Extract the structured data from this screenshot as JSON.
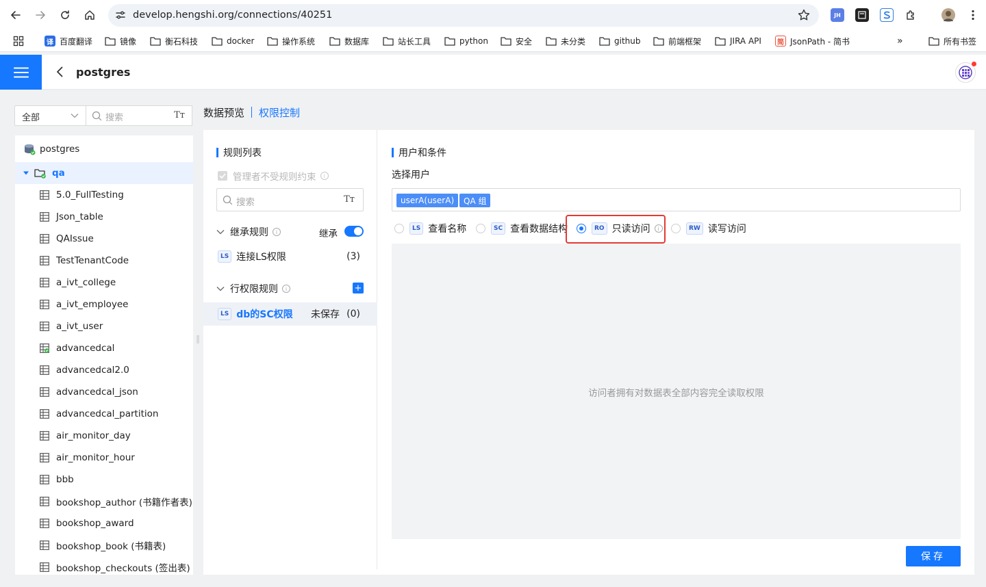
{
  "browser": {
    "url": "develop.hengshi.org/connections/40251",
    "extensions": [
      "JH"
    ]
  },
  "bookmarks": {
    "items": [
      {
        "label": "百度翻译",
        "icon": "baidu-translate-icon"
      },
      {
        "label": "镜像",
        "icon": "folder-icon"
      },
      {
        "label": "衡石科技",
        "icon": "folder-icon"
      },
      {
        "label": "docker",
        "icon": "folder-icon"
      },
      {
        "label": "操作系统",
        "icon": "folder-icon"
      },
      {
        "label": "数据库",
        "icon": "folder-icon"
      },
      {
        "label": "站长工具",
        "icon": "folder-icon"
      },
      {
        "label": "python",
        "icon": "folder-icon"
      },
      {
        "label": "安全",
        "icon": "folder-icon"
      },
      {
        "label": "未分类",
        "icon": "folder-icon"
      },
      {
        "label": "github",
        "icon": "folder-icon"
      },
      {
        "label": "前端框架",
        "icon": "folder-icon"
      },
      {
        "label": "JIRA API",
        "icon": "folder-icon"
      },
      {
        "label": "JsonPath - 简书",
        "icon": "jianshu-icon"
      }
    ],
    "more": "»",
    "all": "所有书签",
    "translate_logo": "译",
    "jianshu_logo": "简"
  },
  "app": {
    "title": "postgres",
    "accent": "#1677ff"
  },
  "filter": {
    "scope": "全部",
    "search_placeholder": "搜索",
    "font_toggle": "Tт"
  },
  "tree": {
    "root": "postgres",
    "schema": "qa",
    "tables": [
      "5.0_FullTesting",
      "Json_table",
      "QAIssue",
      "TestTenantCode",
      "a_ivt_college",
      "a_ivt_employee",
      "a_ivt_user",
      "advancedcal",
      "advancedcal2.0",
      "advancedcal_json",
      "advancedcal_partition",
      "air_monitor_day",
      "air_monitor_hour",
      "bbb",
      "bookshop_author (书籍作者表)",
      "bookshop_award",
      "bookshop_book (书籍表)",
      "bookshop_checkouts (签出表)"
    ]
  },
  "tabs": {
    "preview": "数据预览",
    "permission": "权限控制"
  },
  "rules": {
    "title": "规则列表",
    "admin_exempt": "管理者不受规则约束",
    "search_placeholder": "搜索",
    "font_toggle": "Tт",
    "inherit_group": "继承规则",
    "inherit_label": "继承",
    "inherit_on": true,
    "inherited": [
      {
        "tag": "LS",
        "name": "连接LS权限",
        "count": "(3)"
      }
    ],
    "row_group": "行权限规则",
    "add": "+",
    "row_rules": [
      {
        "tag": "LS",
        "name": "db的SC权限",
        "status": "未保存",
        "count": "(0)"
      }
    ]
  },
  "conditions": {
    "title": "用户和条件",
    "select_user": "选择用户",
    "users": [
      "userA(userA)",
      "QA 组"
    ],
    "access_levels": [
      {
        "tag": "LS",
        "label": "查看名称",
        "selected": false
      },
      {
        "tag": "SC",
        "label": "查看数据结构",
        "selected": false
      },
      {
        "tag": "RO",
        "label": "只读访问",
        "selected": true
      },
      {
        "tag": "RW",
        "label": "读写访问",
        "selected": false
      }
    ],
    "description": "访问者拥有对数据表全部内容完全读取权限",
    "save": "保存"
  }
}
